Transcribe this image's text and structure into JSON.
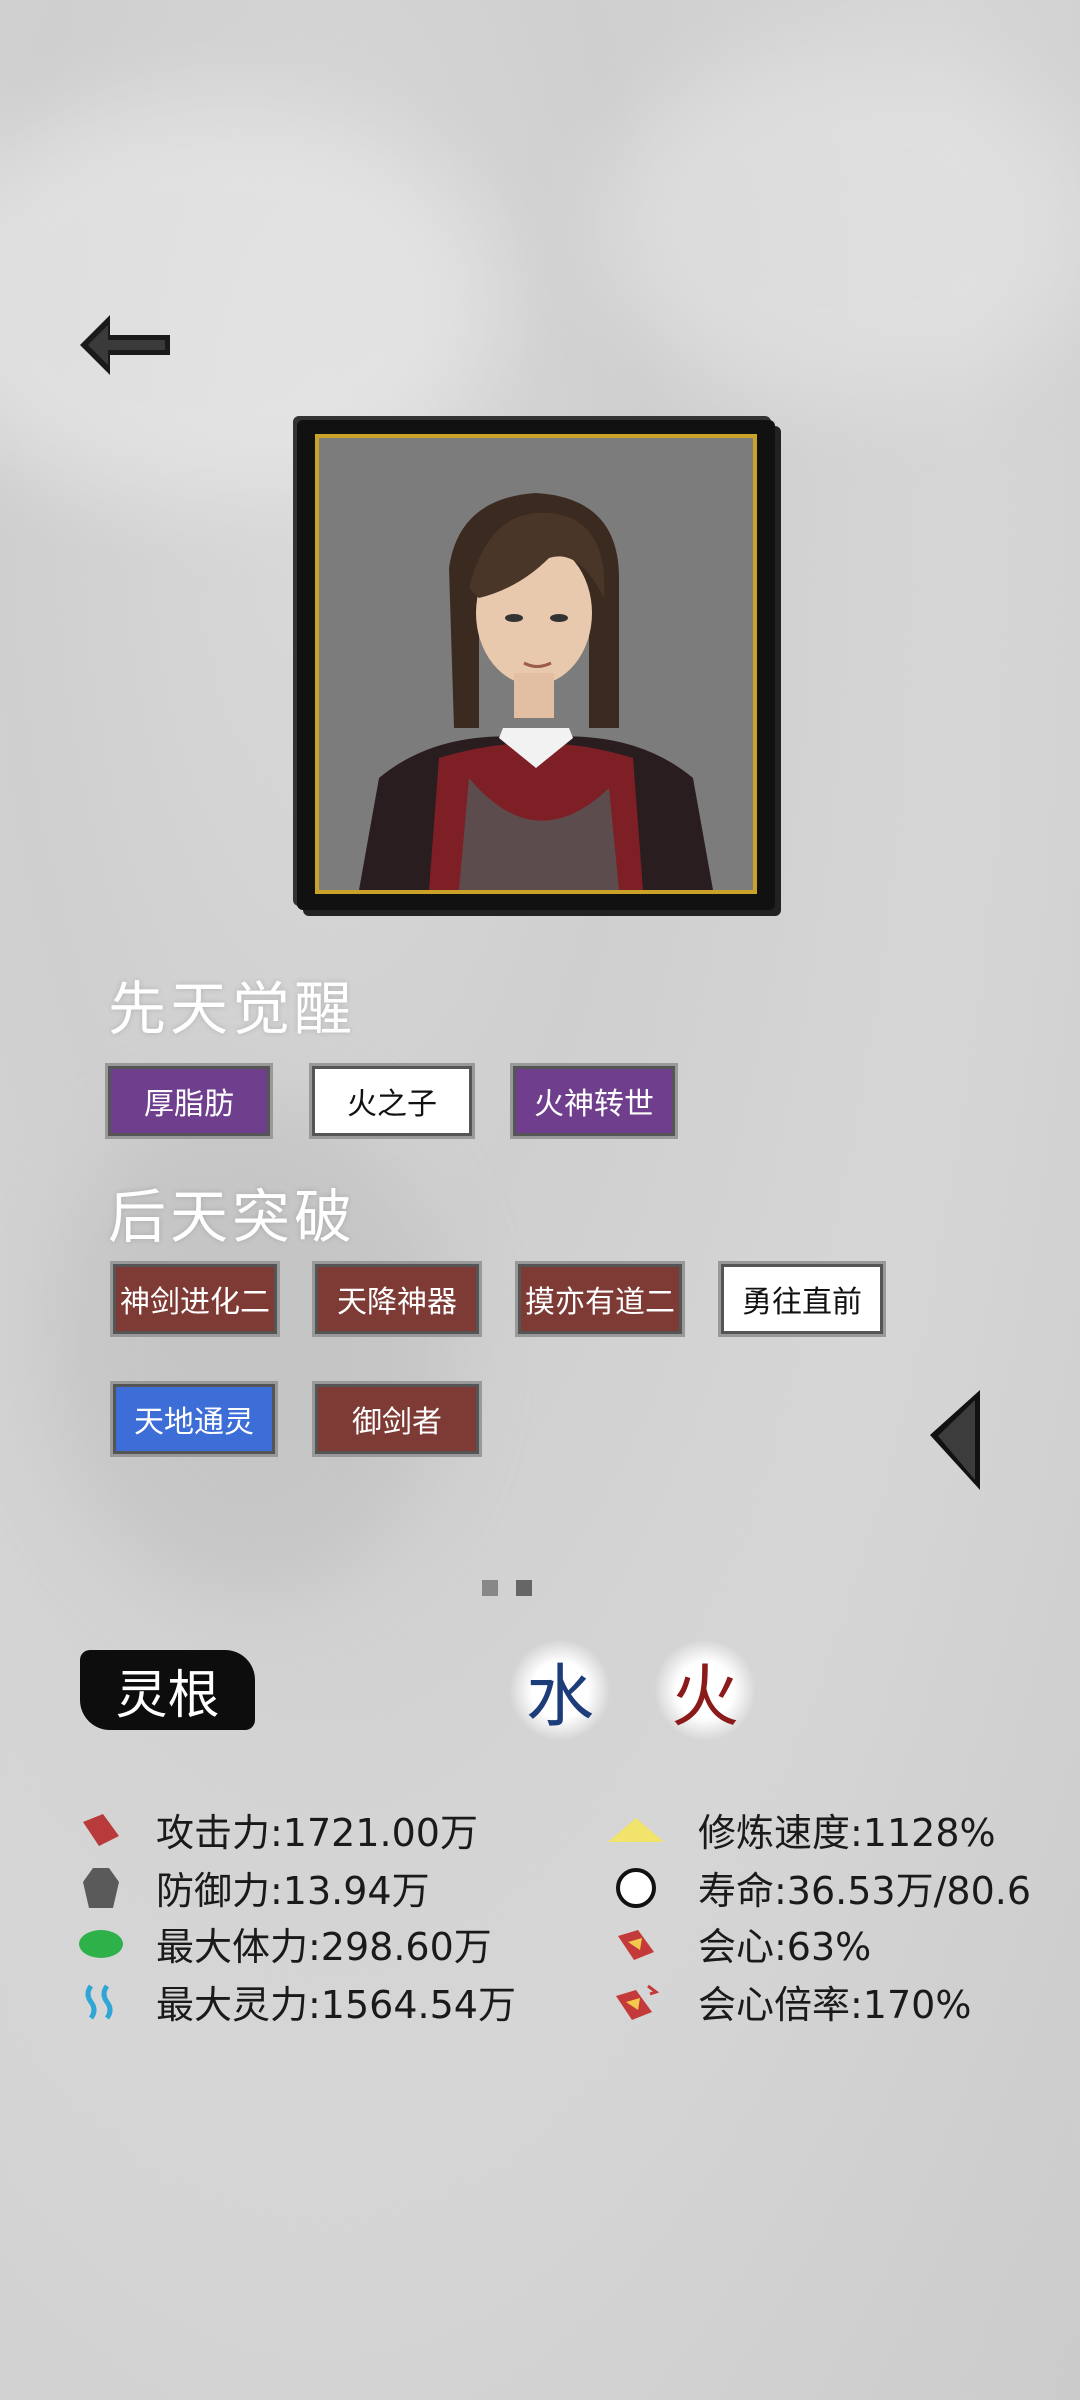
{
  "innate": {
    "title": "先天觉醒",
    "tags": [
      "厚脂肪",
      "火之子",
      "火神转世"
    ]
  },
  "acquired": {
    "title": "后天突破",
    "tags": [
      "神剑进化二",
      "天降神器",
      "摸亦有道二",
      "勇往直前",
      "天地通灵",
      "御剑者"
    ]
  },
  "spirit_root": {
    "label": "灵根",
    "elements": [
      "水",
      "火"
    ],
    "colors": {
      "水": "#1d3d7a",
      "火": "#8b1a1a"
    }
  },
  "stats_left": [
    {
      "icon": "attack-icon",
      "text": "攻击力:1721.00万"
    },
    {
      "icon": "defense-icon",
      "text": "防御力:13.94万"
    },
    {
      "icon": "health-icon",
      "text": "最大体力:298.60万"
    },
    {
      "icon": "spirit-icon",
      "text": "最大灵力:1564.54万"
    }
  ],
  "stats_right": [
    {
      "icon": "cultivation-speed-icon",
      "text": "修炼速度:1128%"
    },
    {
      "icon": "lifespan-icon",
      "text": "寿命:36.53万/80.6"
    },
    {
      "icon": "critical-icon",
      "text": "会心:63%"
    },
    {
      "icon": "critical-multiplier-icon",
      "text": "会心倍率:170%"
    }
  ],
  "pagination": {
    "pages": 2,
    "active": 2
  }
}
